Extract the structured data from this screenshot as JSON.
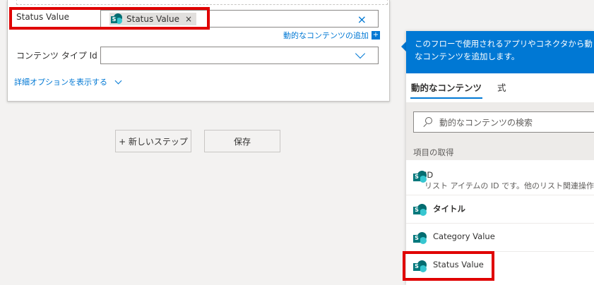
{
  "card": {
    "field1_label": "Status Value",
    "token_label": "Status Value",
    "token_remove": "×",
    "clear_icon": "×",
    "add_dynamic_label": "動的なコンテンツの追加",
    "add_dynamic_icon": "+",
    "field2_label": "コンテンツ タイプ Id",
    "advanced_label": "詳細オプションを表示する"
  },
  "actions": {
    "new_step": "+ 新しいステップ",
    "save": "保存"
  },
  "panel": {
    "banner_line1": "このフローで使用されるアプリやコネクタから動",
    "banner_line2": "なコンテンツを追加します。",
    "tabs": [
      "動的なコンテンツ",
      "式"
    ],
    "search_placeholder": "動的なコンテンツの検索",
    "section_title": "項目の取得",
    "items": [
      {
        "name": "ID",
        "desc": "リスト アイテムの ID です。他のリスト関連操作"
      },
      {
        "name": "タイトル"
      },
      {
        "name": "Category Value"
      },
      {
        "name": "Status Value"
      }
    ]
  },
  "colors": {
    "accent": "#0078d4",
    "highlight": "#e00000",
    "sharepoint": "#036c70"
  }
}
